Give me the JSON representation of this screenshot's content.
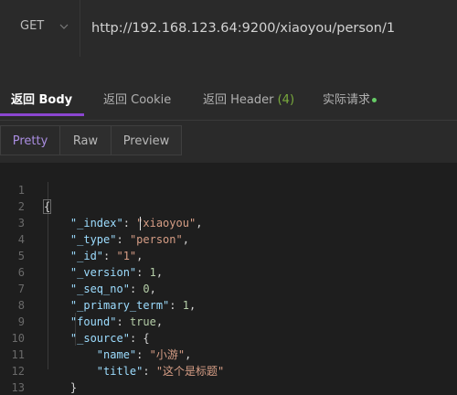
{
  "request": {
    "method": "GET",
    "url": "http://192.168.123.64:9200/xiaoyou/person/1"
  },
  "response_tabs": {
    "body": "返回 Body",
    "cookie": "返回 Cookie",
    "header": "返回 Header",
    "header_count": "(4)",
    "actual": "实际请求"
  },
  "view_buttons": {
    "pretty": "Pretty",
    "raw": "Raw",
    "preview": "Preview"
  },
  "code": {
    "line_numbers": [
      "1",
      "2",
      "3",
      "4",
      "5",
      "6",
      "7",
      "8",
      "9",
      "10",
      "11",
      "12",
      "13"
    ],
    "fields": {
      "index_key": "\"_index\"",
      "index_val": "\"xiaoyou\"",
      "type_key": "\"_type\"",
      "type_val": "\"person\"",
      "id_key": "\"_id\"",
      "id_val": "\"1\"",
      "version_key": "\"_version\"",
      "version_val": "1",
      "seq_no_key": "\"_seq_no\"",
      "seq_no_val": "0",
      "primary_term_key": "\"_primary_term\"",
      "primary_term_val": "1",
      "found_key": "\"found\"",
      "found_val": "true",
      "source_key": "\"_source\"",
      "name_key": "\"name\"",
      "name_val": "\"小游\"",
      "title_key": "\"title\"",
      "title_val": "\"这个是标题\""
    }
  },
  "colors": {
    "accent": "#8b46d0",
    "header_count": "#7aab3d",
    "status_dot": "#66cc66"
  }
}
